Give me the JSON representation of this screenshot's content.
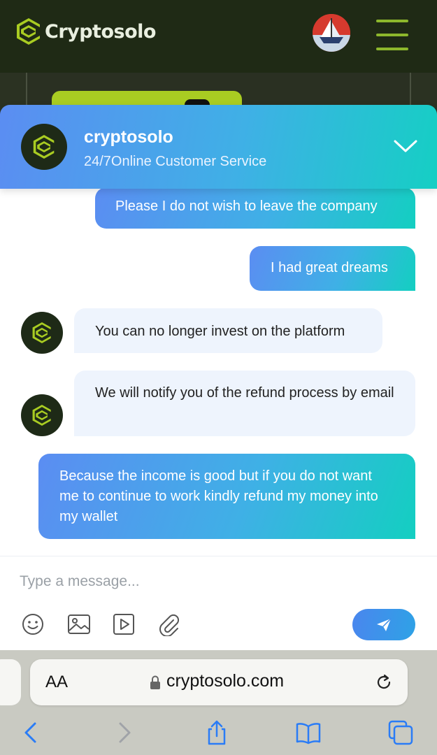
{
  "site": {
    "brand": "Cryptosolo"
  },
  "chat": {
    "title": "cryptosolo",
    "subtitle": "24/7Online Customer Service",
    "messages": [
      {
        "from": "user",
        "text": "Please I do not wish to leave the company"
      },
      {
        "from": "user",
        "text": "I had great dreams"
      },
      {
        "from": "agent",
        "text": "You can no longer invest on the platform"
      },
      {
        "from": "agent",
        "text": "We will notify you of the refund process by email"
      },
      {
        "from": "user",
        "text": "Because the income is good but if you do not want me to continue to work kindly refund my money into my wallet"
      }
    ],
    "input": {
      "value": "",
      "placeholder": "Type a message..."
    }
  },
  "browser": {
    "aa_label": "AA",
    "url": "cryptosolo.com"
  },
  "colors": {
    "brand_green": "#a9cc22",
    "header_dark": "#1f2a15",
    "gradient_start": "#5b8df2",
    "gradient_end": "#15cfc4",
    "accent_blue": "#3b82f6"
  },
  "icons": [
    "menu-icon",
    "flag-icon",
    "chevron-down-icon",
    "emoji-icon",
    "image-icon",
    "video-icon",
    "attachment-icon",
    "send-icon",
    "lock-icon",
    "reload-icon",
    "back-icon",
    "forward-icon",
    "share-icon",
    "bookmarks-icon",
    "tabs-icon"
  ]
}
